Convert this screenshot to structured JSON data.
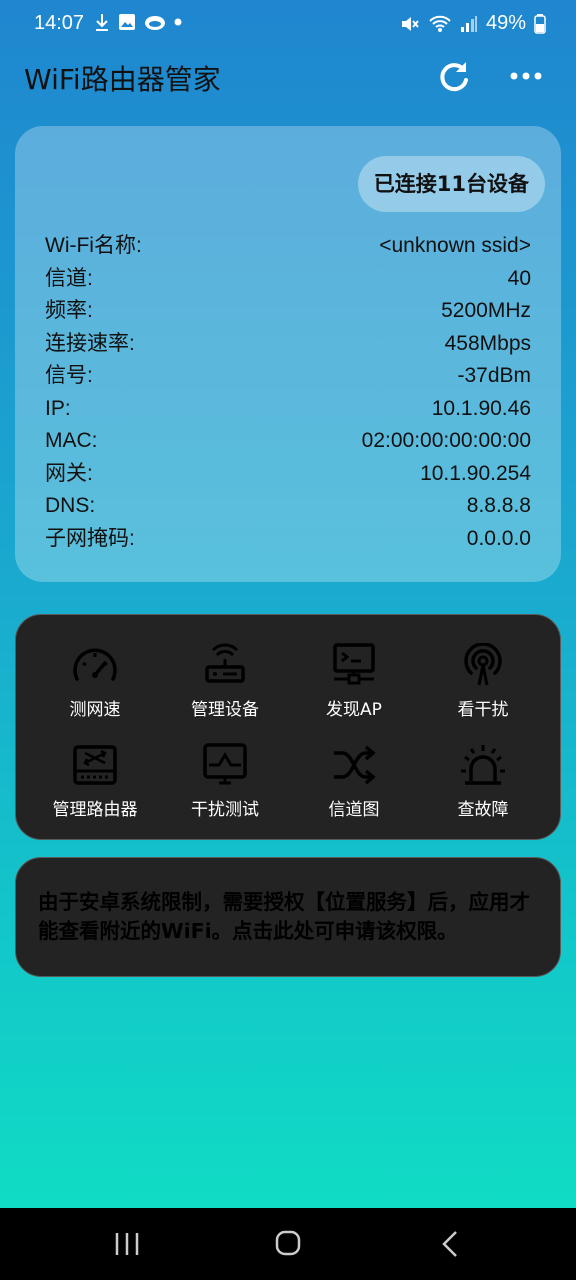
{
  "status_bar": {
    "time": "14:07",
    "battery": "49%",
    "icons": [
      "download-icon",
      "image-icon",
      "cloud-icon",
      "dot-icon",
      "mute-icon",
      "wifi-icon",
      "signal-icon",
      "battery-icon"
    ]
  },
  "app_bar": {
    "title": "WiFi路由器管家",
    "actions": [
      "refresh-icon",
      "more-icon"
    ]
  },
  "connection": {
    "connected_label": "已连接11台设备",
    "rows": [
      {
        "label": "Wi-Fi名称:",
        "value": "<unknown ssid>"
      },
      {
        "label": "信道:",
        "value": "40"
      },
      {
        "label": "频率:",
        "value": "5200MHz"
      },
      {
        "label": "连接速率:",
        "value": "458Mbps"
      },
      {
        "label": "信号:",
        "value": "-37dBm"
      },
      {
        "label": "IP:",
        "value": "10.1.90.46"
      },
      {
        "label": "MAC:",
        "value": "02:00:00:00:00:00"
      },
      {
        "label": "网关:",
        "value": "10.1.90.254"
      },
      {
        "label": "DNS:",
        "value": "8.8.8.8"
      },
      {
        "label": "子网掩码:",
        "value": "0.0.0.0"
      }
    ]
  },
  "tools": [
    {
      "label": "测网速",
      "icon": "speedometer-icon"
    },
    {
      "label": "管理设备",
      "icon": "router-icon"
    },
    {
      "label": "发现AP",
      "icon": "terminal-icon"
    },
    {
      "label": "看干扰",
      "icon": "broadcast-icon"
    },
    {
      "label": "管理路由器",
      "icon": "router-box-icon"
    },
    {
      "label": "干扰测试",
      "icon": "monitor-wave-icon"
    },
    {
      "label": "信道图",
      "icon": "shuffle-icon"
    },
    {
      "label": "查故障",
      "icon": "alarm-light-icon"
    }
  ],
  "notice": {
    "text": "由于安卓系统限制，需要授权【位置服务】后，应用才能查看附近的WiFi。点击此处可申请该权限。"
  },
  "nav": [
    "recent-apps-icon",
    "home-icon",
    "back-icon"
  ]
}
